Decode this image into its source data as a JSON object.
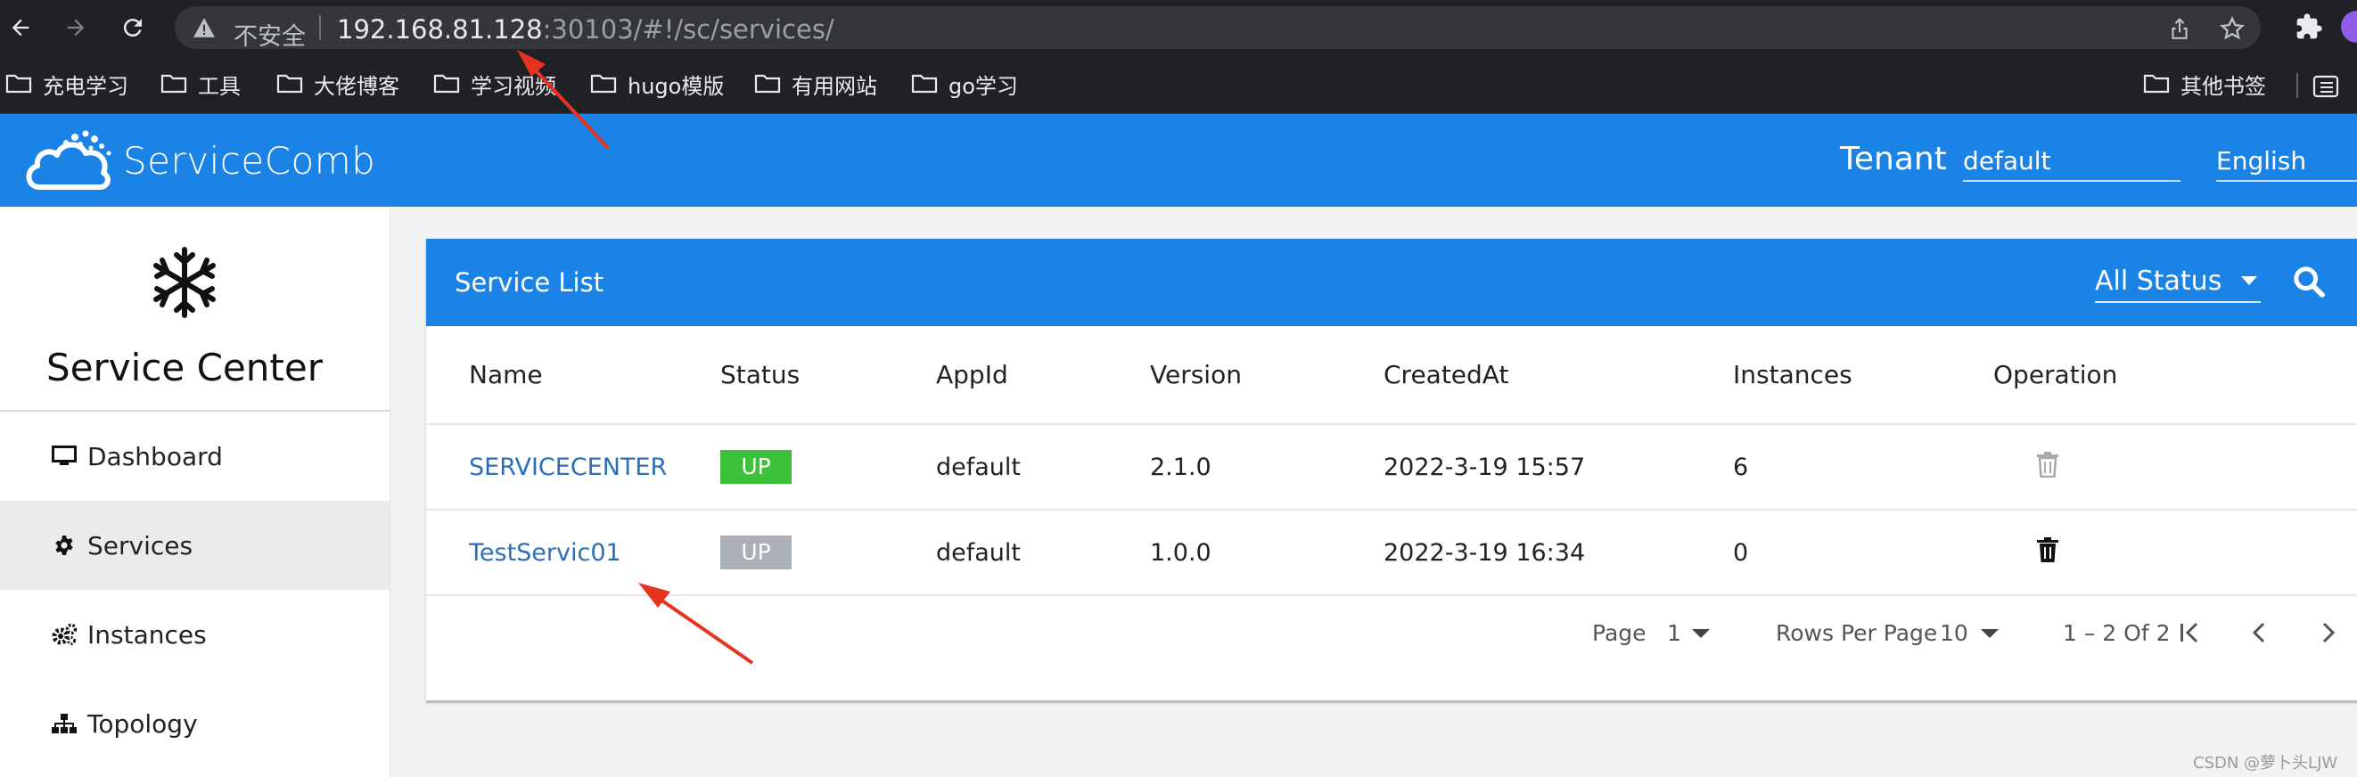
{
  "browser": {
    "address": {
      "insecure_label": "不安全",
      "host": "192.168.81.128",
      "path": ":30103/#!/sc/services/"
    },
    "bookmarks": [
      {
        "label": "充电学习"
      },
      {
        "label": "工具"
      },
      {
        "label": "大佬博客"
      },
      {
        "label": "学习视频"
      },
      {
        "label": "hugo模版"
      },
      {
        "label": "有用网站"
      },
      {
        "label": "go学习"
      },
      {
        "label": "其他书签"
      }
    ]
  },
  "header": {
    "logo_text": "ServiceComb",
    "tenant_label": "Tenant",
    "tenant_value": "default",
    "language": "English",
    "brand_color": "#1c83e6"
  },
  "sidebar": {
    "title": "Service Center",
    "items": [
      {
        "label": "Dashboard",
        "icon": "monitor-icon"
      },
      {
        "label": "Services",
        "icon": "gear-icon",
        "active": true
      },
      {
        "label": "Instances",
        "icon": "gears-icon"
      },
      {
        "label": "Topology",
        "icon": "sitemap-icon"
      }
    ]
  },
  "service_list": {
    "title": "Service List",
    "status_filter": "All Status",
    "columns": [
      "Name",
      "Status",
      "AppId",
      "Version",
      "CreatedAt",
      "Instances",
      "Operation"
    ],
    "rows": [
      {
        "name": "SERVICECENTER",
        "status": "UP",
        "status_color": "#3cc13b",
        "appid": "default",
        "version": "2.1.0",
        "created_at": "2022-3-19 15:57",
        "instances": "6",
        "delete_enabled": false
      },
      {
        "name": "TestServic01",
        "status": "UP",
        "status_color": "#aab0b6",
        "appid": "default",
        "version": "1.0.0",
        "created_at": "2022-3-19 16:34",
        "instances": "0",
        "delete_enabled": true
      }
    ],
    "pagination": {
      "page_label": "Page",
      "page_value": "1",
      "rows_label": "Rows Per Page",
      "rows_value": "10",
      "range_text": "1 – 2 Of 2"
    }
  },
  "watermark": "CSDN @萝卜头LJW"
}
